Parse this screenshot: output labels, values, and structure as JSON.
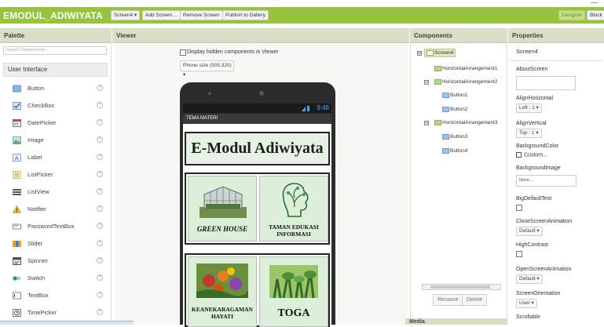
{
  "project_title": "EMODUL_ADIWIYATA",
  "toolbar": {
    "screen_select": "Screen4 ▾",
    "add_screen": "Add Screen ...",
    "remove_screen": "Remove Screen",
    "publish": "Publish to Gallery",
    "designer": "Designer",
    "blocks": "Block"
  },
  "palette": {
    "title": "Palette",
    "search_placeholder": "Search Components...",
    "category": "User Interface",
    "items": [
      "Button",
      "CheckBox",
      "DatePicker",
      "Image",
      "Label",
      "ListPicker",
      "ListView",
      "Notifier",
      "PasswordTextBox",
      "Slider",
      "Spinner",
      "Switch",
      "TextBox",
      "TimePicker"
    ],
    "help": "?"
  },
  "viewer": {
    "title": "Viewer",
    "hidden_label": "Display hidden components in Viewer",
    "phone_size": "Phone size (505,320) ▾",
    "time": "9:48",
    "screen_title": "TEMA MATERI",
    "header_text": "E-Modul Adiwiyata",
    "cells": [
      "GREEN HOUSE",
      "TAMAN EDUKASI INFORMASI",
      "KEANEKARAGAMAN HAYATI",
      "TOGA"
    ]
  },
  "components": {
    "title": "Components",
    "tree": [
      "Screen4",
      "HorizontalArrangement1",
      "HorizontalArrangement2",
      "Button1",
      "Button2",
      "HorizontalArrangement3",
      "Button3",
      "Button4"
    ],
    "toggle": "⊟",
    "rename": "Rename",
    "delete": "Delete",
    "media": "Media"
  },
  "properties": {
    "title": "Properties",
    "component": "Screen4",
    "about": "AboutScreen",
    "align_h": "AlignHorizontal",
    "align_h_val": "Left : 1 ▾",
    "align_v": "AlignVertical",
    "align_v_val": "Top : 1 ▾",
    "bgcolor": "BackgroundColor",
    "bgcolor_val": "Custom...",
    "bgimage": "BackgroundImage",
    "bgimage_val": "None...",
    "bigdefault": "BigDefaultText",
    "close_anim": "CloseScreenAnimation",
    "close_anim_val": "Default ▾",
    "high_contrast": "HighContrast",
    "open_anim": "OpenScreenAnimation",
    "open_anim_val": "Default ▾",
    "orientation": "ScreenOrientation",
    "orientation_val": "User ▾",
    "scrollable": "Scrollable"
  }
}
